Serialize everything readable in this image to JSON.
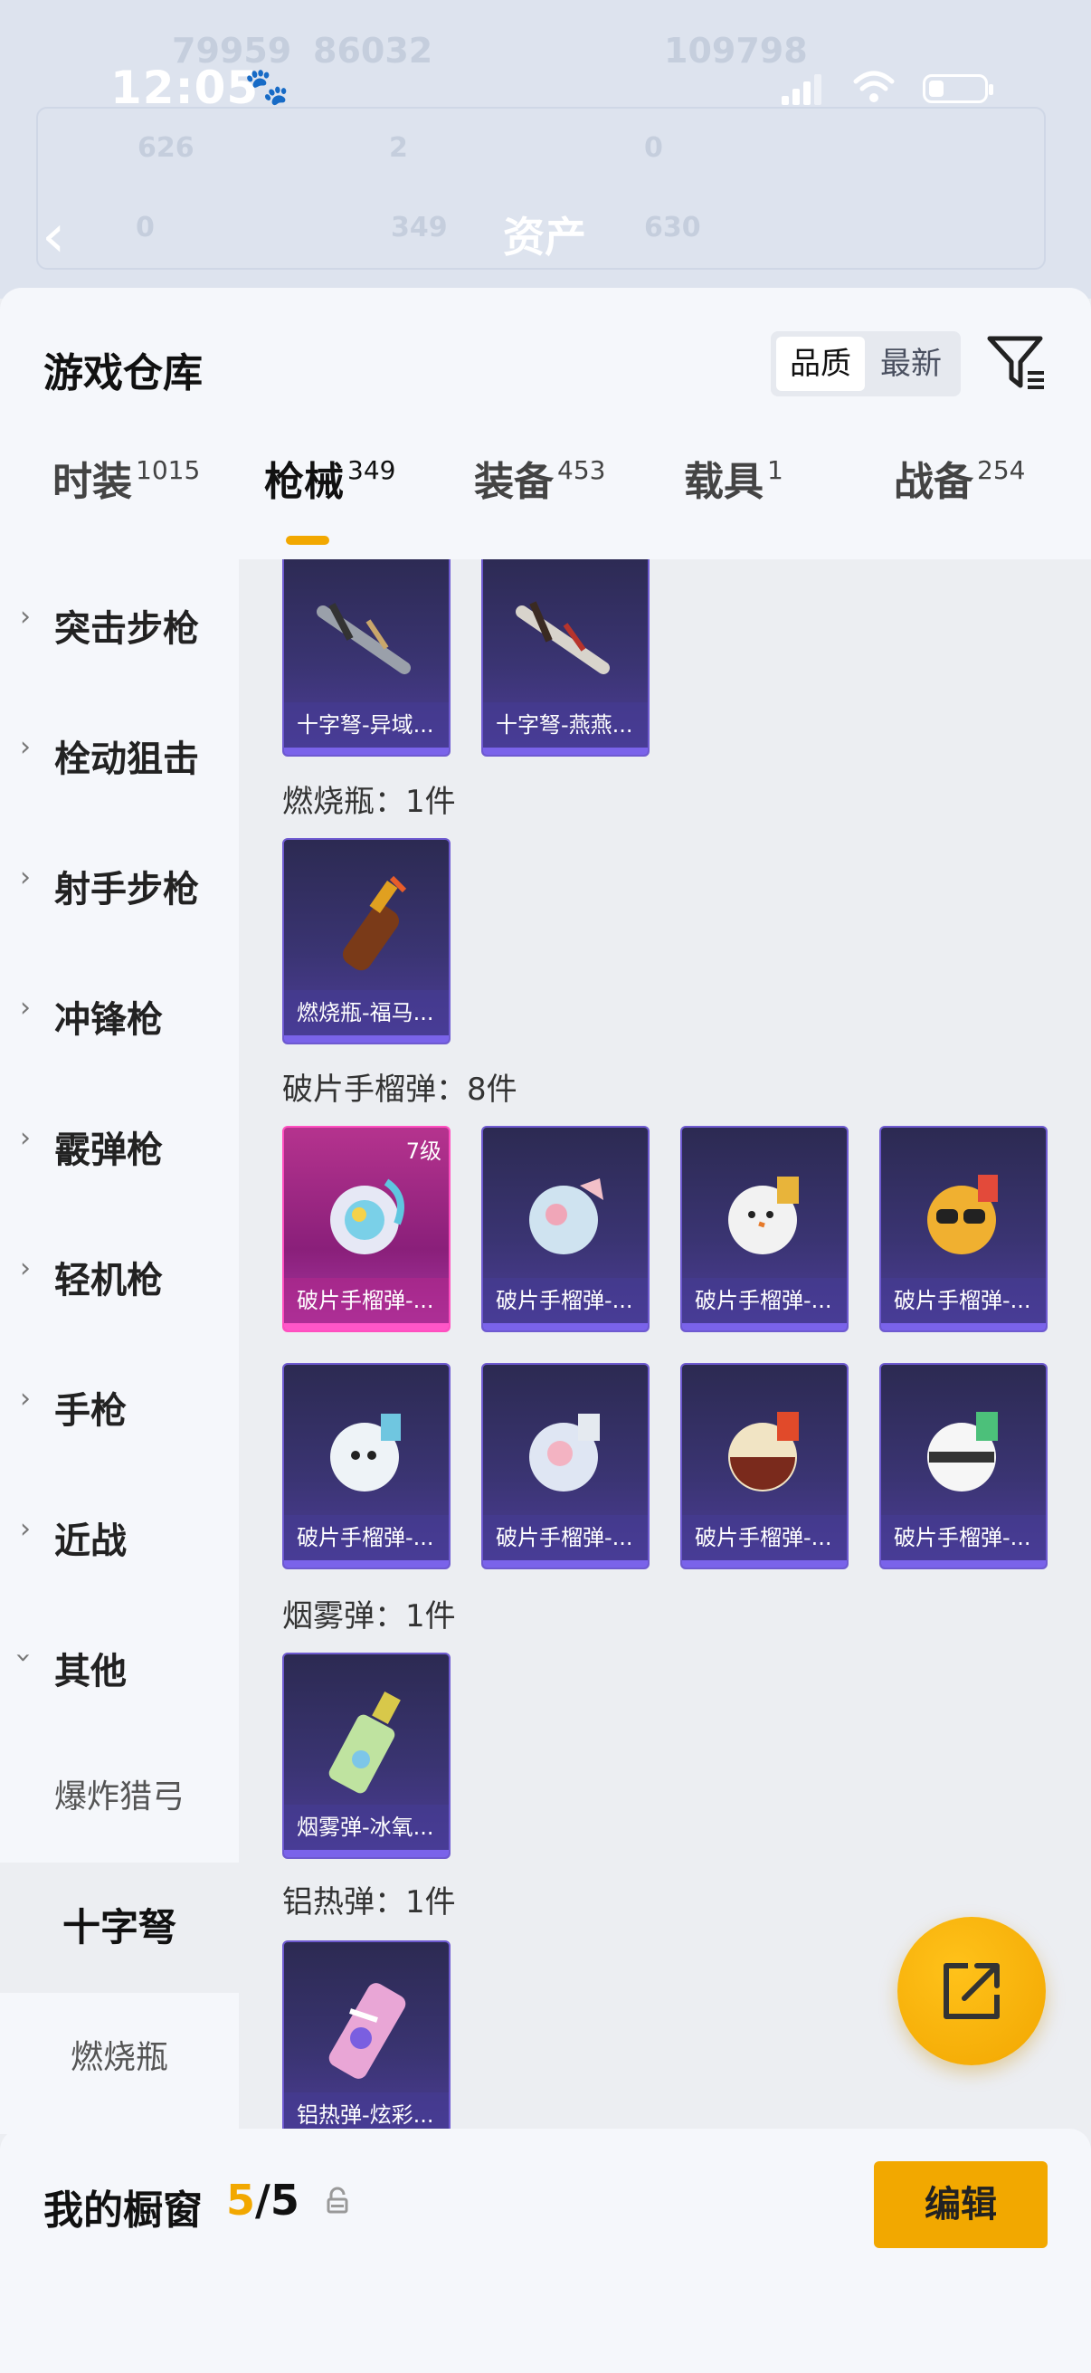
{
  "status": {
    "time": "12:05"
  },
  "background": {
    "title": "资产",
    "ghost": [
      "79959",
      "86032",
      "109798",
      "626",
      "2",
      "0",
      "0",
      "349",
      "630"
    ]
  },
  "sheet": {
    "title": "游戏仓库",
    "sort": {
      "options": [
        "品质",
        "最新"
      ],
      "selected": "品质"
    }
  },
  "tabs": [
    {
      "label": "时装",
      "count": "1015"
    },
    {
      "label": "枪械",
      "count": "349",
      "active": true
    },
    {
      "label": "装备",
      "count": "453"
    },
    {
      "label": "载具",
      "count": "1"
    },
    {
      "label": "战备",
      "count": "254"
    }
  ],
  "sidebar": {
    "categories": [
      "突击步枪",
      "栓动狙击",
      "射手步枪",
      "冲锋枪",
      "霰弹枪",
      "轻机枪",
      "手枪",
      "近战",
      "其他"
    ],
    "subitems": [
      "爆炸猎弓",
      "十字弩",
      "燃烧瓶"
    ],
    "active_sub": "十字弩"
  },
  "content": {
    "crossbow_items": [
      "十字弩-异域...",
      "十字弩-燕燕..."
    ],
    "sections": [
      {
        "title": "燃烧瓶：1件",
        "items": [
          {
            "name": "燃烧瓶-福马..."
          }
        ]
      },
      {
        "title": "破片手榴弹：8件",
        "items": [
          {
            "name": "破片手榴弹-...",
            "level": "7级",
            "rarity": "pink"
          },
          {
            "name": "破片手榴弹-..."
          },
          {
            "name": "破片手榴弹-..."
          },
          {
            "name": "破片手榴弹-..."
          },
          {
            "name": "破片手榴弹-..."
          },
          {
            "name": "破片手榴弹-..."
          },
          {
            "name": "破片手榴弹-..."
          },
          {
            "name": "破片手榴弹-..."
          }
        ]
      },
      {
        "title": "烟雾弹：1件",
        "items": [
          {
            "name": "烟雾弹-冰氧..."
          }
        ]
      },
      {
        "title": "铝热弹：1件",
        "items": [
          {
            "name": "铝热弹-炫彩..."
          }
        ]
      }
    ]
  },
  "bottom": {
    "label": "我的橱窗",
    "current": "5",
    "total": "/5",
    "edit_label": "编辑"
  },
  "colors": {
    "accent": "#f2a800",
    "card_purple": "#3a3472",
    "card_pink": "#b5338e"
  }
}
